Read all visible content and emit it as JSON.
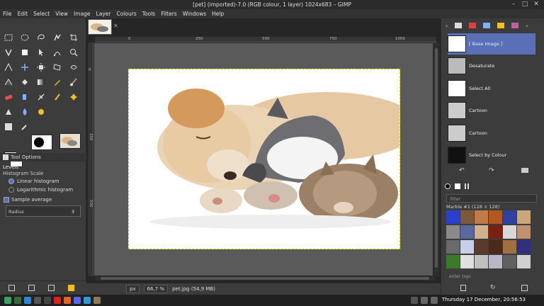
{
  "window": {
    "title": "[pet] (imported)-7.0 (RGB colour, 1 layer) 1024x683 – GIMP",
    "min": "–",
    "max": "□",
    "close": "✕"
  },
  "menu": [
    "File",
    "Edit",
    "Select",
    "View",
    "Image",
    "Layer",
    "Colours",
    "Tools",
    "Filters",
    "Windows",
    "Help"
  ],
  "tool_options": {
    "tab_label": "Tool Options",
    "tool": "Levels",
    "histogram_scale_label": "Histogram Scale",
    "linear": "Linear histogram",
    "logarithmic": "Logarithmic histogram",
    "sample_average": "Sample average",
    "radius_label": "Radius",
    "radius_value": "3"
  },
  "ruler": {
    "t0": "0",
    "t250": "250",
    "t500": "500",
    "t750": "750",
    "t1000": "1000",
    "v0": "0",
    "v250": "250",
    "v500": "500"
  },
  "status": {
    "unit": "px",
    "zoom": "66,7 %",
    "file": "pet.jpg (54,9 MB)"
  },
  "undo_history": [
    {
      "label": "[ Base Image ]",
      "selected": true
    },
    {
      "label": "Desaturate"
    },
    {
      "label": "Select All"
    },
    {
      "label": "Cartoon"
    },
    {
      "label": "Cartoon"
    },
    {
      "label": "Select by Colour"
    }
  ],
  "patterns": {
    "filter_placeholder": "filter",
    "name": "Marble #1 (128 × 128)",
    "tags_placeholder": "enter tags"
  },
  "taskbar": {
    "clock": "Thursday 17 December, 20:56:53"
  },
  "colors": {
    "selection": "#5a6fb5",
    "accent": "#f0c020"
  }
}
